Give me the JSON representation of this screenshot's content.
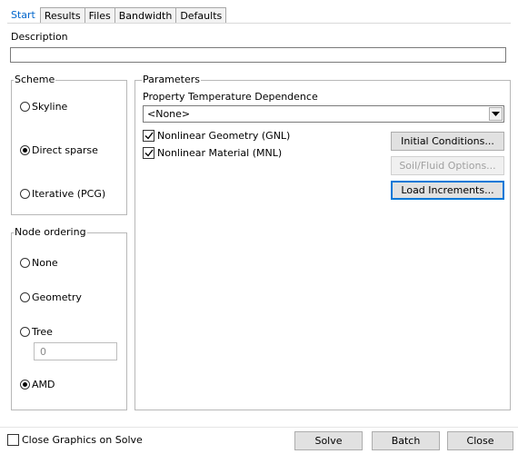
{
  "tabs": [
    {
      "label": "Start",
      "active": true
    },
    {
      "label": "Results",
      "active": false
    },
    {
      "label": "Files",
      "active": false
    },
    {
      "label": "Bandwidth",
      "active": false
    },
    {
      "label": "Defaults",
      "active": false
    }
  ],
  "description": {
    "label": "Description",
    "value": ""
  },
  "scheme": {
    "title": "Scheme",
    "options": [
      {
        "label": "Skyline",
        "checked": false
      },
      {
        "label": "Direct sparse",
        "checked": true
      },
      {
        "label": "Iterative (PCG)",
        "checked": false
      }
    ]
  },
  "node_ordering": {
    "title": "Node ordering",
    "options": [
      {
        "label": "None",
        "checked": false
      },
      {
        "label": "Geometry",
        "checked": false
      },
      {
        "label": "Tree",
        "checked": false
      },
      {
        "label": "AMD",
        "checked": true
      }
    ],
    "tree_value": "0"
  },
  "parameters": {
    "title": "Parameters",
    "property_temp_label": "Property Temperature Dependence",
    "property_temp_value": "<None>",
    "nonlinear_geometry": {
      "label": "Nonlinear Geometry (GNL)",
      "checked": true
    },
    "nonlinear_material": {
      "label": "Nonlinear Material (MNL)",
      "checked": true
    },
    "initial_conditions_label": "Initial Conditions...",
    "soil_fluid_label": "Soil/Fluid Options...",
    "load_increments_label": "Load Increments..."
  },
  "footer": {
    "close_graphics": {
      "label": "Close Graphics on Solve",
      "checked": false
    },
    "solve_label": "Solve",
    "batch_label": "Batch",
    "close_label": "Close"
  },
  "colors": {
    "active_tab": "#0066cc",
    "focus": "#0078d7"
  }
}
